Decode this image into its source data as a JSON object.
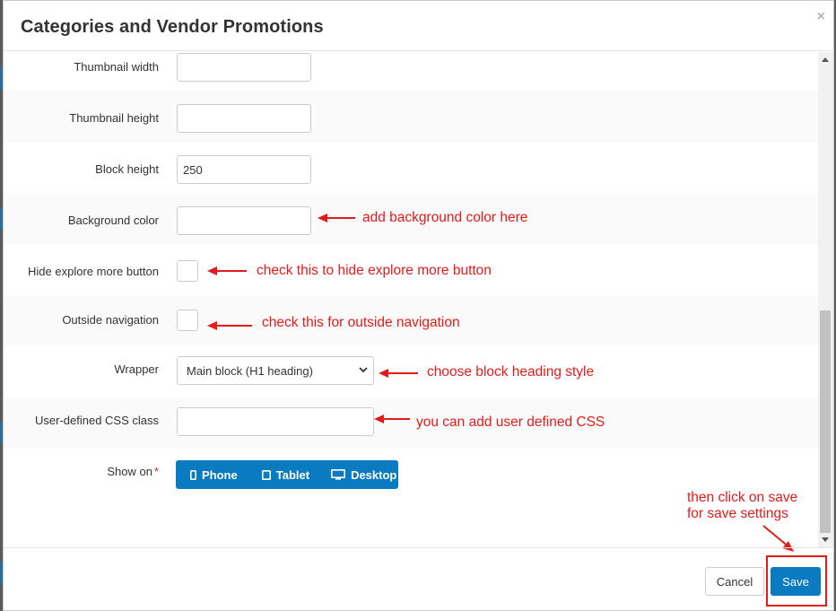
{
  "dialog": {
    "title": "Categories and Vendor Promotions",
    "close_symbol": "×"
  },
  "form": {
    "thumbnail_width": {
      "label": "Thumbnail width",
      "value": ""
    },
    "thumbnail_height": {
      "label": "Thumbnail height",
      "value": ""
    },
    "block_height": {
      "label": "Block height",
      "value": "250"
    },
    "background_color": {
      "label": "Background color",
      "value": ""
    },
    "hide_explore": {
      "label": "Hide explore more button",
      "checked": false
    },
    "outside_navigation": {
      "label": "Outside navigation",
      "checked": false
    },
    "wrapper": {
      "label": "Wrapper",
      "selected": "Main block (H1 heading)"
    },
    "css_class": {
      "label": "User-defined CSS class",
      "value": ""
    },
    "show_on": {
      "label": "Show on",
      "required_mark": "*",
      "options": [
        {
          "label": "Phone",
          "icon": "phone-icon"
        },
        {
          "label": "Tablet",
          "icon": "tablet-icon"
        },
        {
          "label": "Desktop",
          "icon": "desktop-icon"
        }
      ]
    }
  },
  "annotations": {
    "background": "add background color here",
    "hide_explore": "check this to hide explore more button",
    "outside_nav": "check this for outside navigation",
    "wrapper": "choose block heading style",
    "css": "you can add user defined CSS",
    "save_line1": "then click on save",
    "save_line2": "for save settings"
  },
  "footer": {
    "cancel_label": "Cancel",
    "save_label": "Save"
  },
  "colors": {
    "primary": "#0b7bc1",
    "annotation": "#e21b1b"
  }
}
